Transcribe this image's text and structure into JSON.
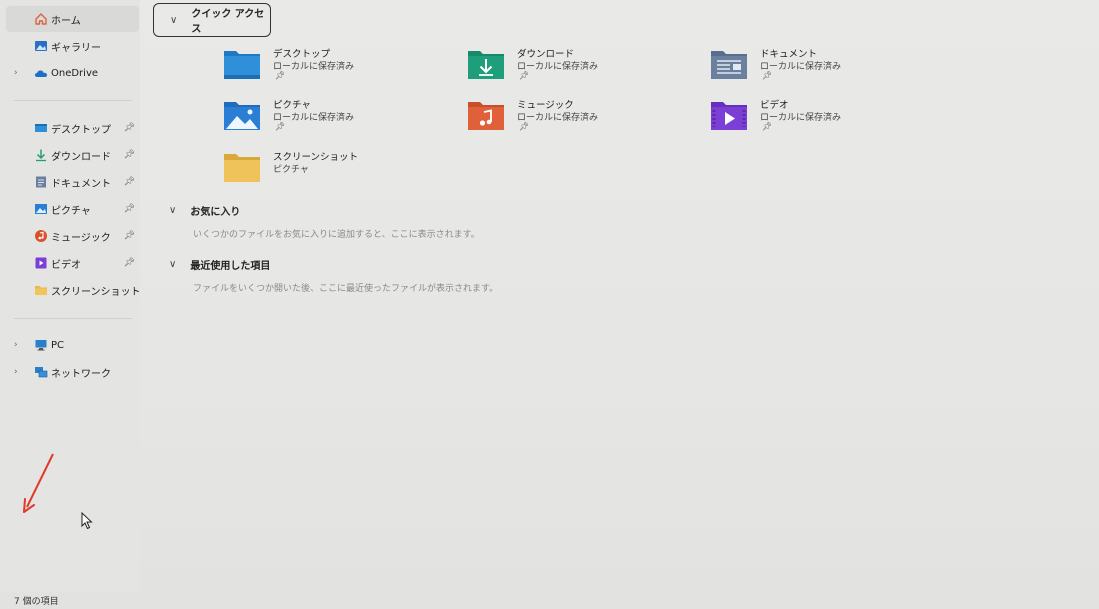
{
  "sidebar": {
    "home": "ホーム",
    "gallery": "ギャラリー",
    "onedrive": "OneDrive",
    "pinned": [
      {
        "label": "デスクトップ",
        "icon": "desktop-icon"
      },
      {
        "label": "ダウンロード",
        "icon": "download-icon"
      },
      {
        "label": "ドキュメント",
        "icon": "document-icon"
      },
      {
        "label": "ピクチャ",
        "icon": "picture-icon"
      },
      {
        "label": "ミュージック",
        "icon": "music-icon"
      },
      {
        "label": "ビデオ",
        "icon": "video-icon"
      },
      {
        "label": "スクリーンショット",
        "icon": "folder-icon"
      }
    ],
    "pc": "PC",
    "network": "ネットワーク"
  },
  "quick_access": {
    "title": "クイック アクセス",
    "items": [
      {
        "name": "デスクトップ",
        "location": "ローカルに保存済み",
        "pinned": true,
        "icon": "desktop-folder-icon"
      },
      {
        "name": "ダウンロード",
        "location": "ローカルに保存済み",
        "pinned": true,
        "icon": "download-folder-icon"
      },
      {
        "name": "ドキュメント",
        "location": "ローカルに保存済み",
        "pinned": true,
        "icon": "document-folder-icon"
      },
      {
        "name": "ピクチャ",
        "location": "ローカルに保存済み",
        "pinned": true,
        "icon": "picture-folder-icon"
      },
      {
        "name": "ミュージック",
        "location": "ローカルに保存済み",
        "pinned": true,
        "icon": "music-folder-icon"
      },
      {
        "name": "ビデオ",
        "location": "ローカルに保存済み",
        "pinned": true,
        "icon": "video-folder-icon"
      },
      {
        "name": "スクリーンショット",
        "location": "ピクチャ",
        "pinned": false,
        "icon": "screenshot-folder-icon"
      }
    ]
  },
  "favorites": {
    "title": "お気に入り",
    "description": "いくつかのファイルをお気に入りに追加すると、ここに表示されます。"
  },
  "recent": {
    "title": "最近使用した項目",
    "description": "ファイルをいくつか開いた後、ここに最近使ったファイルが表示されます。"
  },
  "status": {
    "item_count": "7 個の項目"
  },
  "colors": {
    "desktop": "#2f8fd8",
    "download": "#1e9e7a",
    "document": "#6b7f9e",
    "picture": "#2a7fd4",
    "music": "#e0603a",
    "video": "#7b3fd6",
    "folder": "#e8b84a",
    "arrow": "#e03a2a"
  }
}
